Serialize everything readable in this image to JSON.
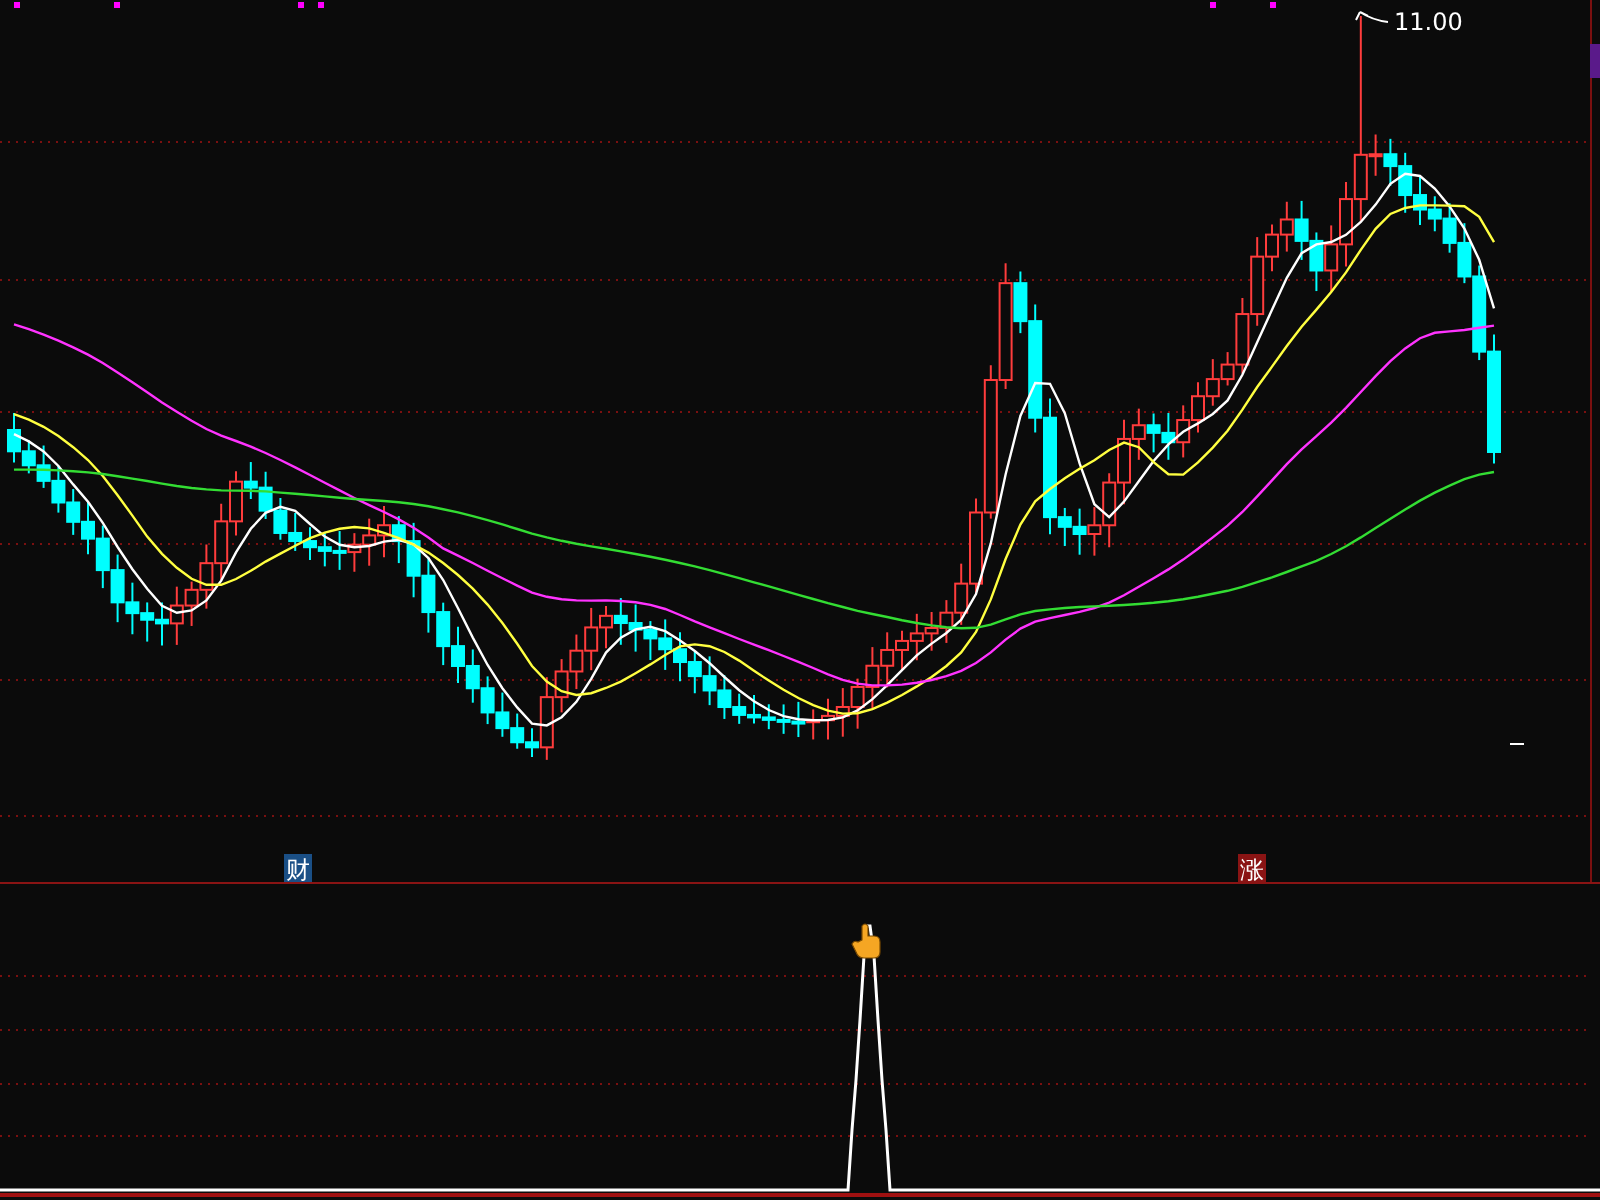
{
  "price_chart": {
    "high_label": "11.00"
  },
  "event_markers": [
    {
      "text": "财",
      "color": "#1a4f86"
    },
    {
      "text": "涨",
      "color": "#8a1414"
    }
  ]
}
